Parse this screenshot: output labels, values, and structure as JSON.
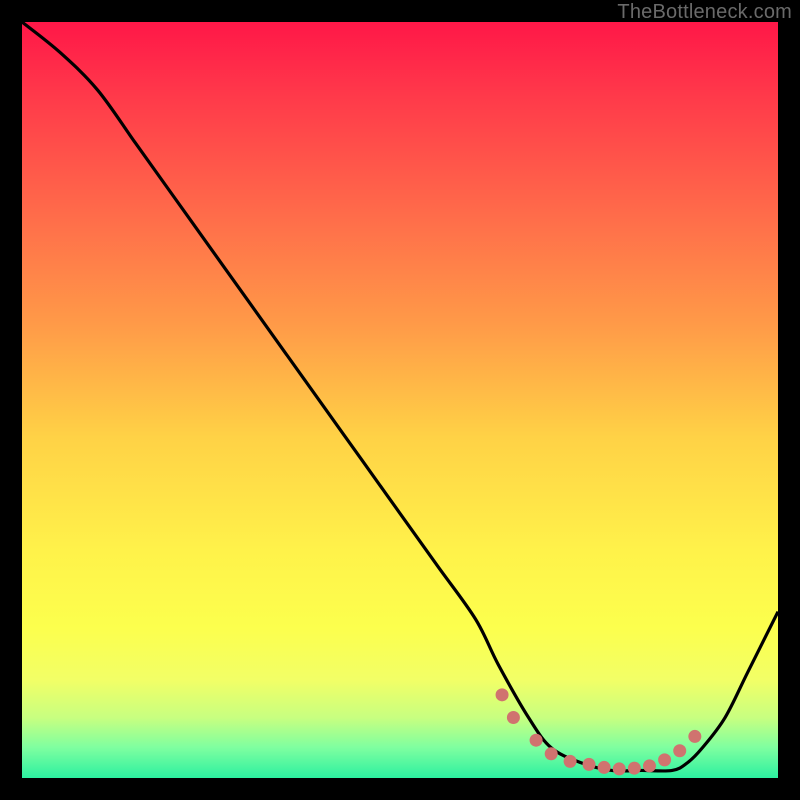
{
  "watermark": "TheBottleneck.com",
  "colors": {
    "background": "#000000",
    "curve": "#000000",
    "dots": "#d0736f",
    "gradient_top": "#ff1748",
    "gradient_bottom": "#2cf0a0"
  },
  "chart_data": {
    "type": "line",
    "title": "",
    "xlabel": "",
    "ylabel": "",
    "xlim": [
      0,
      100
    ],
    "ylim": [
      0,
      100
    ],
    "series": [
      {
        "name": "bottleneck-curve",
        "x": [
          0,
          5,
          10,
          15,
          20,
          25,
          30,
          35,
          40,
          45,
          50,
          55,
          60,
          63,
          67,
          70,
          74,
          78,
          82,
          86,
          88,
          90,
          93,
          96,
          100
        ],
        "y": [
          100,
          96,
          91,
          84,
          77,
          70,
          63,
          56,
          49,
          42,
          35,
          28,
          21,
          15,
          8,
          4,
          2,
          1,
          1,
          1,
          2,
          4,
          8,
          14,
          22
        ]
      }
    ],
    "dot_markers": {
      "name": "optimal-range-dots",
      "x": [
        63.5,
        65,
        68,
        70,
        72.5,
        75,
        77,
        79,
        81,
        83,
        85,
        87,
        89
      ],
      "y": [
        11,
        8,
        5,
        3.2,
        2.2,
        1.8,
        1.4,
        1.2,
        1.3,
        1.6,
        2.4,
        3.6,
        5.5
      ]
    }
  }
}
